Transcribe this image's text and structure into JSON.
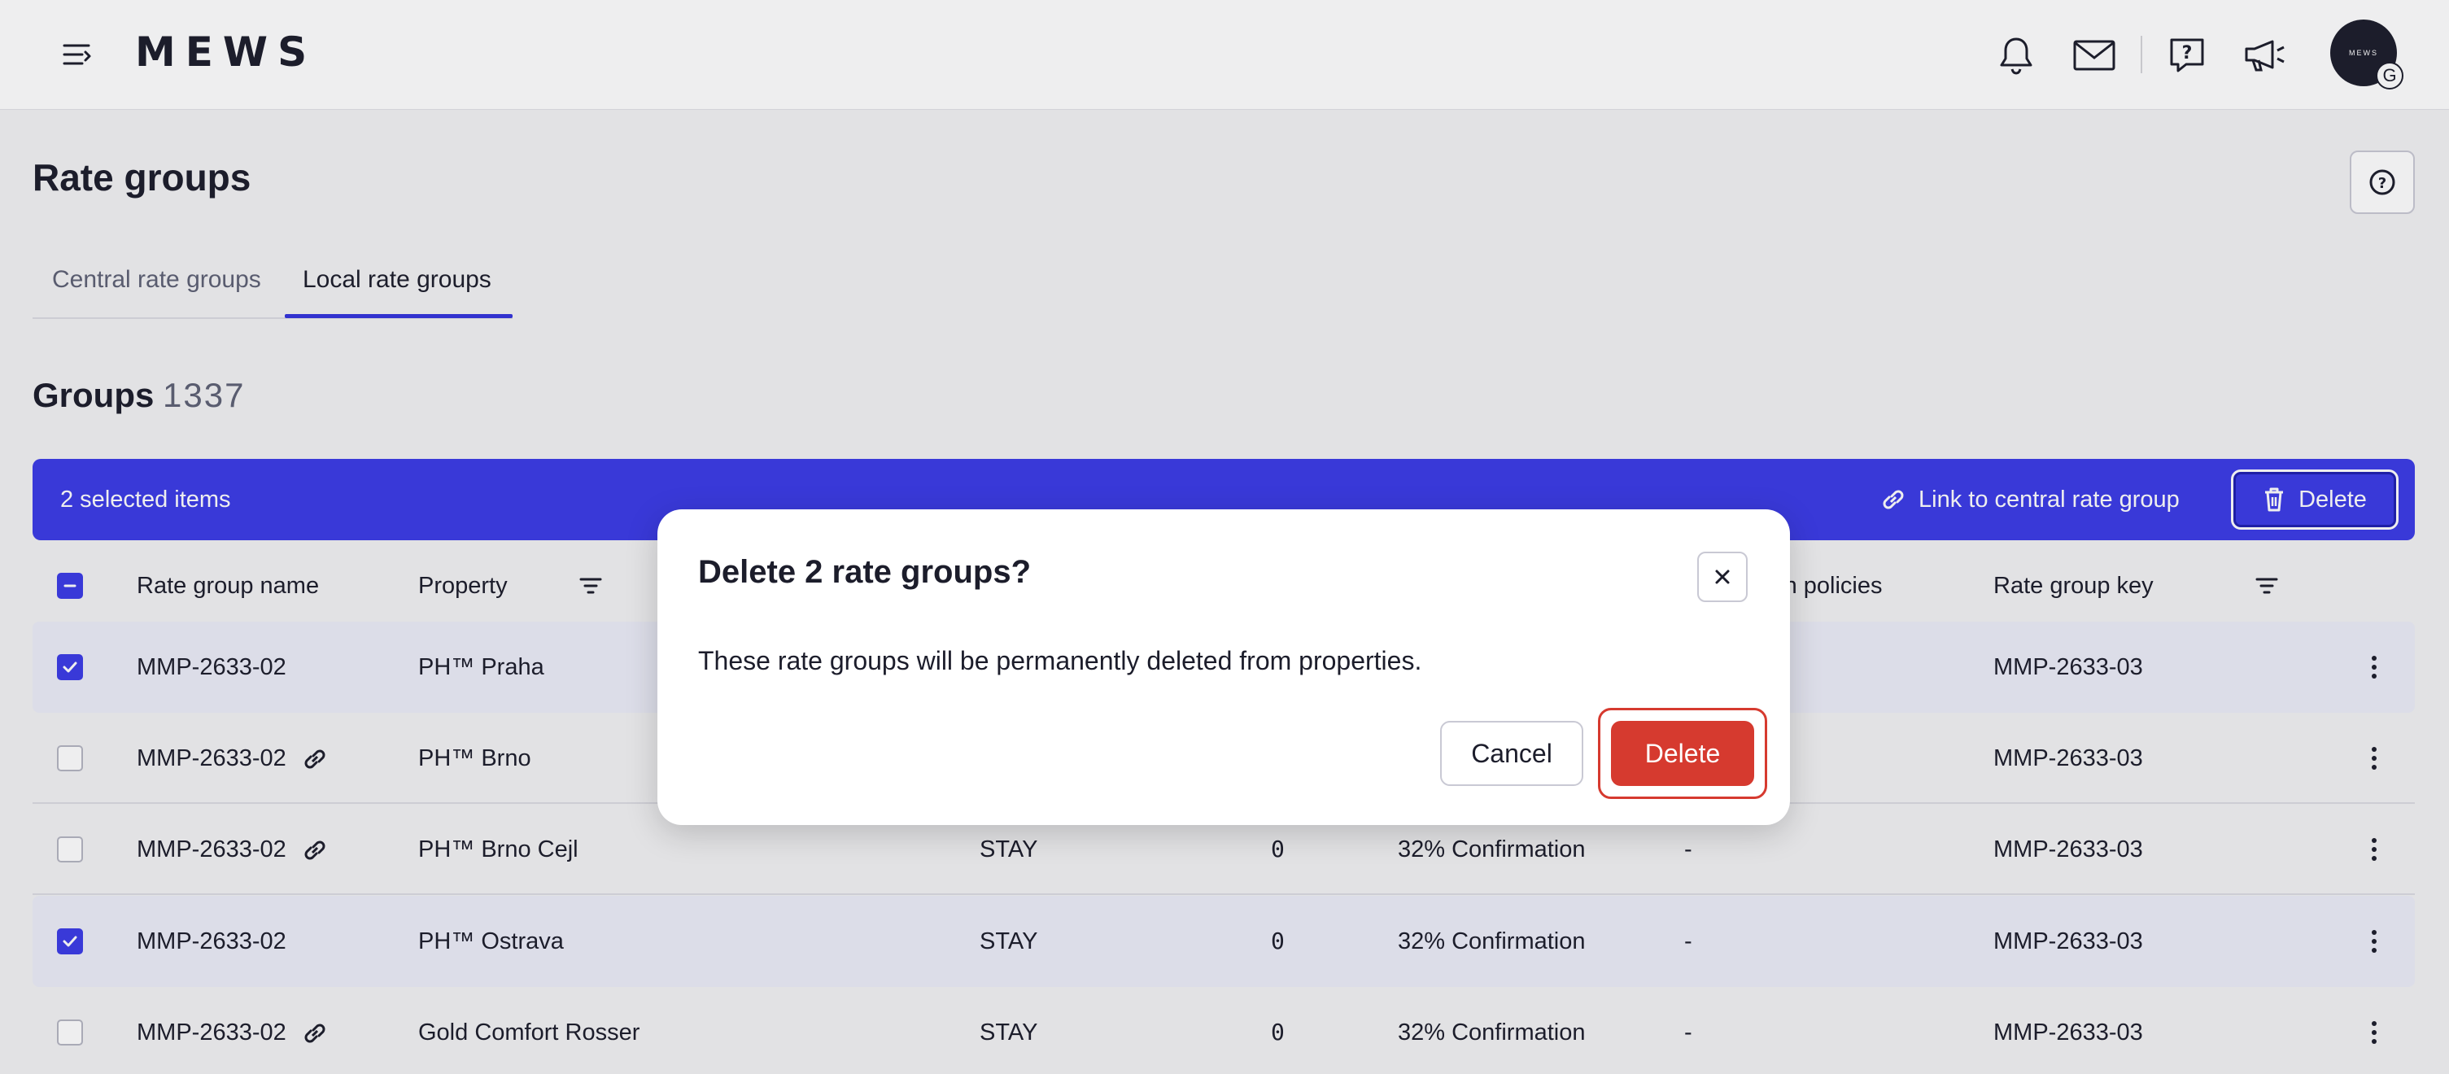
{
  "topbar": {
    "logo": "MEWS",
    "icons": [
      "menu-icon",
      "bell-icon",
      "mail-icon",
      "help-chat-icon",
      "megaphone-icon"
    ],
    "avatar_text": "MEWS",
    "avatar_badge": "G"
  },
  "page": {
    "title": "Rate groups",
    "tabs": [
      {
        "label": "Central rate groups",
        "active": false
      },
      {
        "label": "Local rate groups",
        "active": true
      }
    ],
    "groups_title": "Groups",
    "groups_count": "1337"
  },
  "selection_bar": {
    "count_label": "2 selected items",
    "link_label": "Link to central rate group",
    "delete_label": "Delete"
  },
  "table": {
    "headers": {
      "name": "Rate group name",
      "property": "Property",
      "policies": "ion policies",
      "key": "Rate group key"
    },
    "rows": [
      {
        "selected": true,
        "linked": false,
        "name": "MMP-2633-02",
        "property": "PH™ Praha",
        "type": "",
        "count": "",
        "policy": "",
        "dash": "",
        "key": "MMP-2633-03"
      },
      {
        "selected": false,
        "linked": true,
        "name": "MMP-2633-02",
        "property": "PH™ Brno",
        "type": "",
        "count": "",
        "policy": "",
        "dash": "",
        "key": "MMP-2633-03"
      },
      {
        "selected": false,
        "linked": true,
        "name": "MMP-2633-02",
        "property": "PH™ Brno Cejl",
        "type": "STAY",
        "count": "0",
        "policy": "32% Confirmation",
        "dash": "-",
        "key": "MMP-2633-03"
      },
      {
        "selected": true,
        "linked": false,
        "name": "MMP-2633-02",
        "property": "PH™ Ostrava",
        "type": "STAY",
        "count": "0",
        "policy": "32% Confirmation",
        "dash": "-",
        "key": "MMP-2633-03"
      },
      {
        "selected": false,
        "linked": true,
        "name": "MMP-2633-02",
        "property": "Gold Comfort Rosser",
        "type": "STAY",
        "count": "0",
        "policy": "32% Confirmation",
        "dash": "-",
        "key": "MMP-2633-03"
      }
    ]
  },
  "dialog": {
    "title": "Delete 2 rate groups?",
    "body": "These rate groups will be permanently deleted from properties.",
    "cancel_label": "Cancel",
    "delete_label": "Delete"
  },
  "colors": {
    "accent": "#3b3be6",
    "danger": "#d63a2f",
    "text": "#1c1d2b"
  }
}
